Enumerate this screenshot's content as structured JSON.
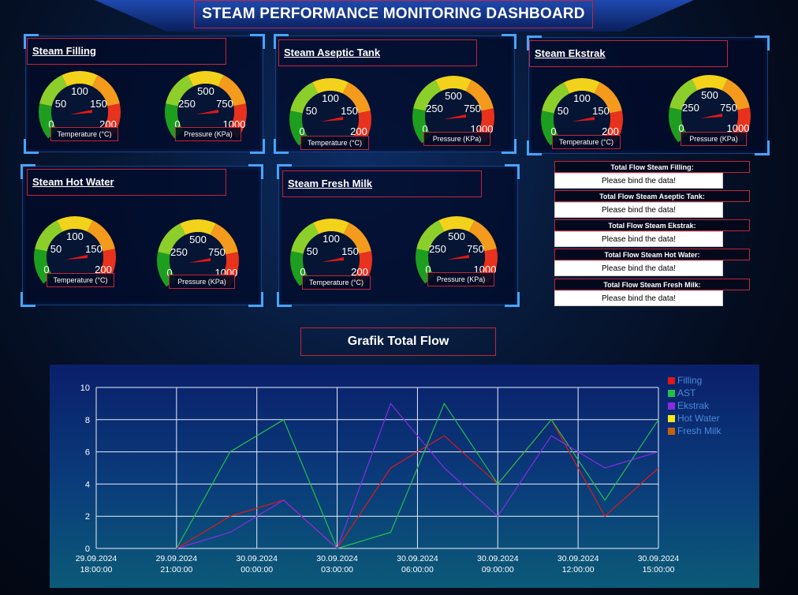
{
  "header": {
    "title": "STEAM PERFORMANCE MONITORING DASHBOARD"
  },
  "panels": [
    {
      "title": "Steam Filling",
      "temp": {
        "label": "Temperature (°C)",
        "ticks": [
          "0",
          "50",
          "100",
          "150",
          "200"
        ]
      },
      "pres": {
        "label": "Pressure (KPa)",
        "ticks": [
          "0",
          "250",
          "500",
          "750",
          "1000"
        ]
      }
    },
    {
      "title": "Steam Aseptic Tank",
      "temp": {
        "label": "Temperature (°C)",
        "ticks": [
          "0",
          "50",
          "100",
          "150",
          "200"
        ]
      },
      "pres": {
        "label": "Pressure (KPa)",
        "ticks": [
          "0",
          "250",
          "500",
          "750",
          "1000"
        ]
      }
    },
    {
      "title": "Steam Ekstrak",
      "temp": {
        "label": "Temperature (°C)",
        "ticks": [
          "0",
          "50",
          "100",
          "150",
          "200"
        ]
      },
      "pres": {
        "label": "Pressure (KPa)",
        "ticks": [
          "0",
          "250",
          "500",
          "750",
          "1000"
        ]
      }
    },
    {
      "title": "Steam Hot Water",
      "temp": {
        "label": "Temperature (°C)",
        "ticks": [
          "0",
          "50",
          "100",
          "150",
          "200"
        ]
      },
      "pres": {
        "label": "Pressure (KPa)",
        "ticks": [
          "0",
          "250",
          "500",
          "750",
          "1000"
        ]
      }
    },
    {
      "title": "Steam Fresh Milk",
      "temp": {
        "label": "Temperature (°C)",
        "ticks": [
          "0",
          "50",
          "100",
          "150",
          "200"
        ]
      },
      "pres": {
        "label": "Pressure (KPa)",
        "ticks": [
          "0",
          "250",
          "500",
          "750",
          "1000"
        ]
      }
    }
  ],
  "gauge_colors": [
    "#1e9e1e",
    "#8ccf2a",
    "#f2d21a",
    "#f49a1c",
    "#e8321e"
  ],
  "needle_color": "#e01818",
  "total_flow": [
    {
      "label": "Total Flow Steam Filling:",
      "value": "Please bind the data!"
    },
    {
      "label": "Total Flow Steam Aseptic Tank:",
      "value": "Please bind the data!"
    },
    {
      "label": "Total Flow Steam Ekstrak:",
      "value": "Please bind the data!"
    },
    {
      "label": "Total Flow Steam Hot Water:",
      "value": "Please bind the data!"
    },
    {
      "label": "Total Flow Steam Fresh Milk:",
      "value": "Please bind the data!"
    }
  ],
  "chart_title": "Grafik Total Flow",
  "chart_data": {
    "type": "line",
    "ylim": [
      0,
      10
    ],
    "yticks": [
      0,
      2,
      4,
      6,
      8,
      10
    ],
    "xlim": [
      0,
      21
    ],
    "xticks": [
      {
        "x": 0,
        "label": [
          "29.09.2024",
          "18:00:00"
        ]
      },
      {
        "x": 3,
        "label": [
          "29.09.2024",
          "21:00:00"
        ]
      },
      {
        "x": 6,
        "label": [
          "30.09.2024",
          "00:00:00"
        ]
      },
      {
        "x": 9,
        "label": [
          "30.09.2024",
          "03:00:00"
        ]
      },
      {
        "x": 12,
        "label": [
          "30.09.2024",
          "06:00:00"
        ]
      },
      {
        "x": 15,
        "label": [
          "30.09.2024",
          "09:00:00"
        ]
      },
      {
        "x": 18,
        "label": [
          "30.09.2024",
          "12:00:00"
        ]
      },
      {
        "x": 21,
        "label": [
          "30.09.2024",
          "15:00:00"
        ]
      }
    ],
    "grid": true,
    "legend_position": "top-right",
    "series": [
      {
        "name": "Filling",
        "color": "#e01818",
        "points": [
          [
            3,
            0
          ],
          [
            5,
            2
          ],
          [
            7,
            3
          ],
          [
            9,
            0
          ],
          [
            11,
            5
          ],
          [
            13,
            7
          ],
          [
            15,
            4
          ],
          [
            17,
            8
          ],
          [
            19,
            2
          ],
          [
            21,
            5
          ]
        ]
      },
      {
        "name": "AST",
        "color": "#22c04a",
        "points": [
          [
            3,
            0
          ],
          [
            5,
            6
          ],
          [
            7,
            8
          ],
          [
            9,
            0
          ],
          [
            11,
            1
          ],
          [
            13,
            9
          ],
          [
            15,
            4
          ],
          [
            17,
            8
          ],
          [
            19,
            3
          ],
          [
            21,
            8
          ]
        ]
      },
      {
        "name": "Ekstrak",
        "color": "#8a2be2",
        "points": [
          [
            3,
            0
          ],
          [
            5,
            1
          ],
          [
            7,
            3
          ],
          [
            9,
            0
          ],
          [
            11,
            9
          ],
          [
            13,
            5
          ],
          [
            15,
            2
          ],
          [
            17,
            7
          ],
          [
            19,
            5
          ],
          [
            21,
            6
          ]
        ]
      },
      {
        "name": "Hot Water",
        "color": "#f2e81a",
        "points": []
      },
      {
        "name": "Fresh Milk",
        "color": "#c8620e",
        "points": []
      }
    ]
  }
}
